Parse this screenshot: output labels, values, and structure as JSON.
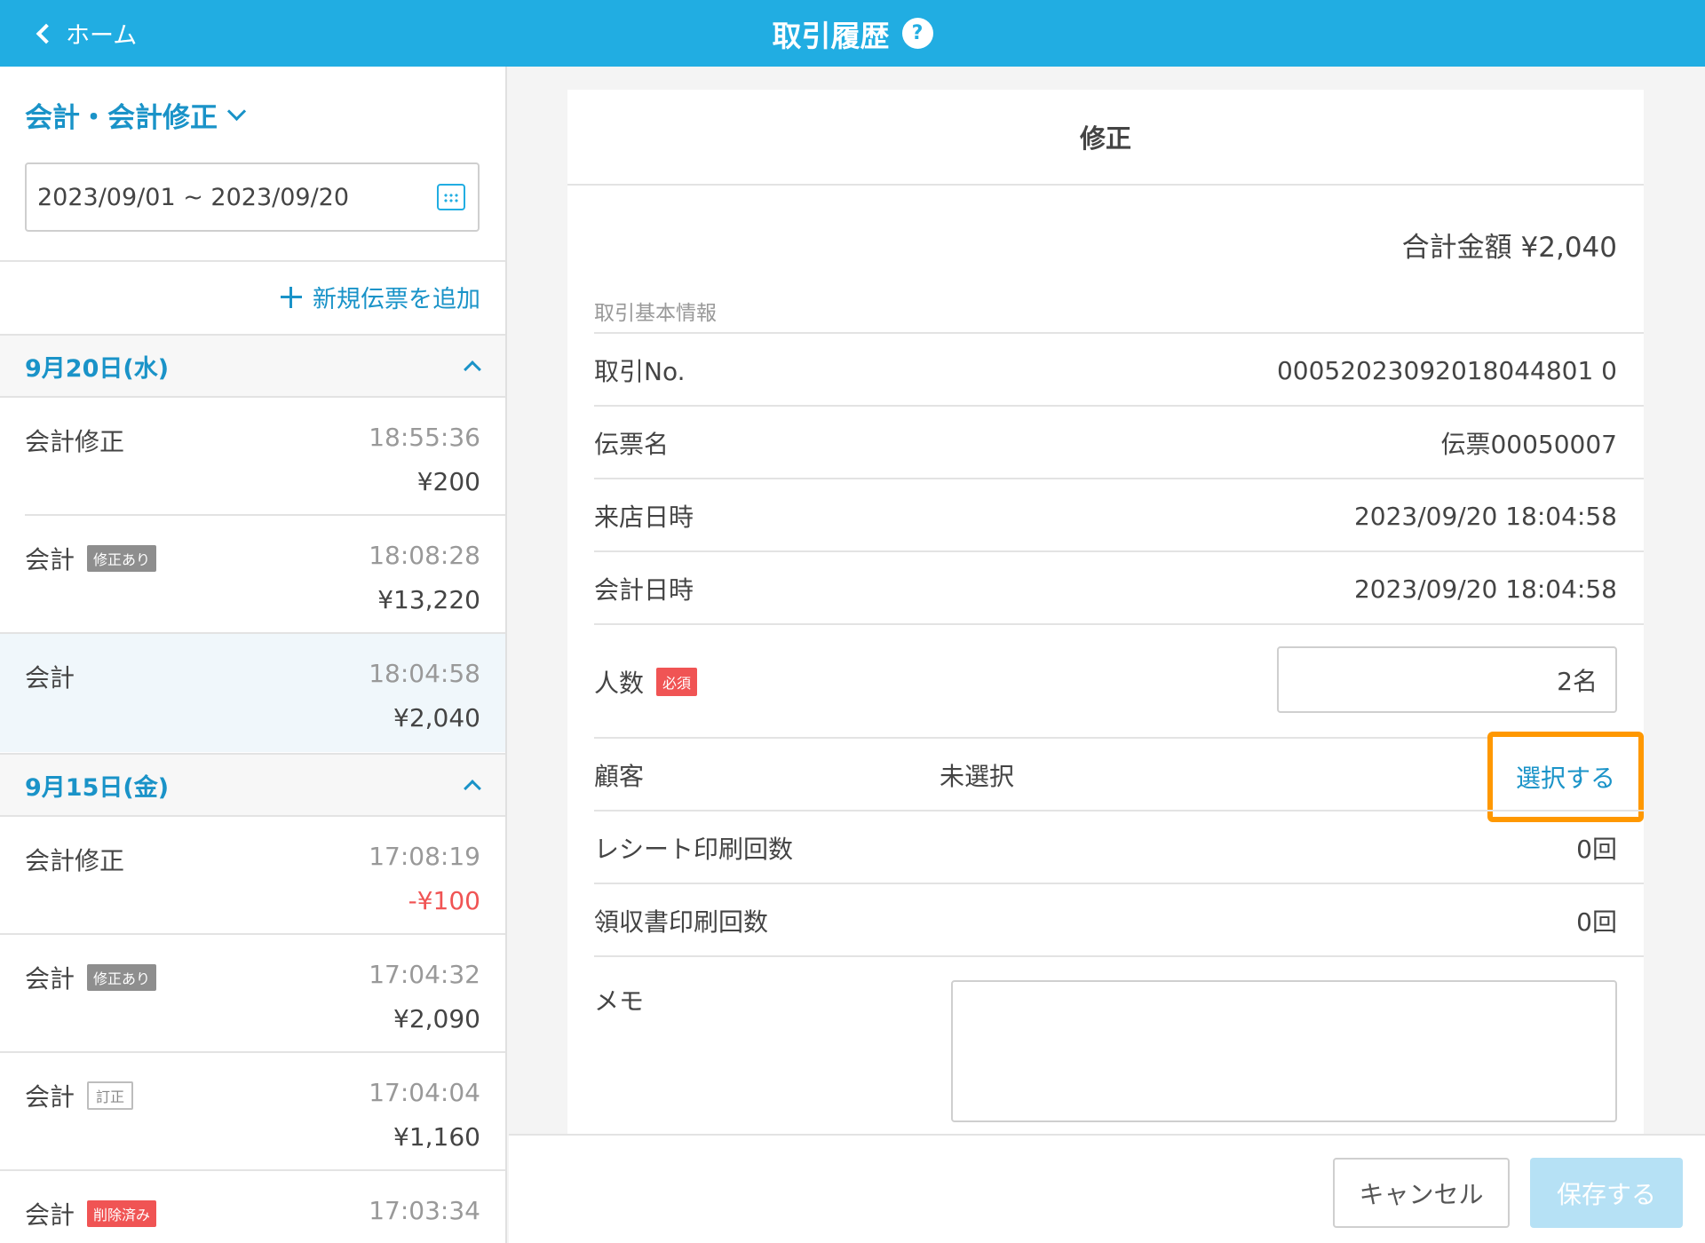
{
  "header": {
    "back_label": "ホーム",
    "title": "取引履歴",
    "help_symbol": "?"
  },
  "sidebar": {
    "mode_label": "会計・会計修正",
    "date_range": "2023/09/01 ~ 2023/09/20",
    "add_new_label": "新規伝票を追加",
    "groups": [
      {
        "date": "9月20日(水)",
        "items": [
          {
            "type": "会計修正",
            "badge": "",
            "time": "18:55:36",
            "amount": "¥200"
          },
          {
            "type": "会計",
            "badge": "修正あり",
            "time": "18:08:28",
            "amount": "¥13,220"
          },
          {
            "type": "会計",
            "badge": "",
            "time": "18:04:58",
            "amount": "¥2,040"
          }
        ]
      },
      {
        "date": "9月15日(金)",
        "items": [
          {
            "type": "会計修正",
            "badge": "",
            "time": "17:08:19",
            "amount": "-¥100"
          },
          {
            "type": "会計",
            "badge": "修正あり",
            "time": "17:04:32",
            "amount": "¥2,090"
          },
          {
            "type": "会計",
            "badge": "訂正",
            "time": "17:04:04",
            "amount": "¥1,160"
          },
          {
            "type": "会計",
            "badge": "削除済み",
            "time": "17:03:34",
            "amount": ""
          }
        ]
      }
    ]
  },
  "detail": {
    "title": "修正",
    "total": "合計金額 ¥2,040",
    "section_label": "取引基本情報",
    "rows": {
      "txn_no": {
        "label": "取引No.",
        "value": "00052023092018044801 0"
      },
      "slip_name": {
        "label": "伝票名",
        "value": "伝票00050007"
      },
      "visit_time": {
        "label": "来店日時",
        "value": "2023/09/20 18:04:58"
      },
      "pay_time": {
        "label": "会計日時",
        "value": "2023/09/20 18:04:58"
      },
      "people": {
        "label": "人数",
        "required": "必須",
        "value": "2名"
      },
      "customer": {
        "label": "顧客",
        "value": "未選択",
        "action": "選択する"
      },
      "receipt_count": {
        "label": "レシート印刷回数",
        "value": "0回"
      },
      "invoice_count": {
        "label": "領収書印刷回数",
        "value": "0回"
      },
      "memo": {
        "label": "メモ",
        "value": ""
      }
    }
  },
  "footer": {
    "cancel_label": "キャンセル",
    "save_label": "保存する"
  },
  "colors": {
    "header": "#21ade2",
    "accent": "#1a93c8",
    "required": "#f05454",
    "highlight": "#ff9800",
    "save_disabled": "#b6e1f5"
  }
}
